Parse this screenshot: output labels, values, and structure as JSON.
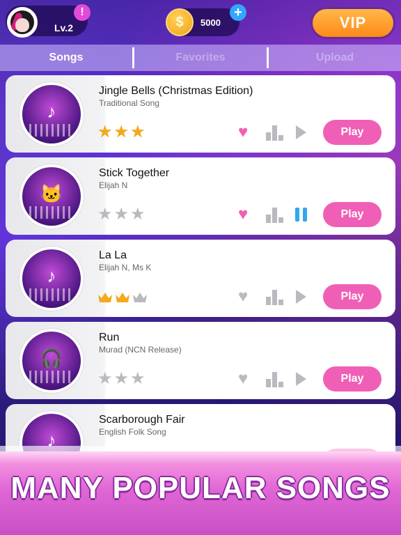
{
  "header": {
    "level": "Lv.2",
    "notification_icon": "!",
    "coins": "5000",
    "add_coins_icon": "+",
    "coin_symbol": "$",
    "vip_label": "VIP"
  },
  "tabs": [
    {
      "label": "Songs",
      "active": true
    },
    {
      "label": "Favorites",
      "active": false
    },
    {
      "label": "Upload",
      "active": false
    }
  ],
  "songs": [
    {
      "title": "Jingle Bells (Christmas Edition)",
      "artist": "Traditional Song",
      "disc_icon": "♪",
      "rating_type": "stars",
      "rating": 3,
      "rating_max": 3,
      "favorite": true,
      "playing": false,
      "button": "Play"
    },
    {
      "title": "Stick Together",
      "artist": "Elijah N",
      "disc_icon": "🐱",
      "rating_type": "stars",
      "rating": 0,
      "rating_max": 3,
      "favorite": true,
      "playing": true,
      "button": "Play"
    },
    {
      "title": "La La",
      "artist": "Elijah N, Ms K",
      "disc_icon": "♪",
      "rating_type": "crowns",
      "rating": 2,
      "rating_max": 3,
      "favorite": false,
      "playing": false,
      "button": "Play"
    },
    {
      "title": "Run",
      "artist": "Murad (NCN Release)",
      "disc_icon": "🎧",
      "rating_type": "stars",
      "rating": 0,
      "rating_max": 3,
      "favorite": false,
      "playing": false,
      "button": "Play"
    },
    {
      "title": "Scarborough Fair",
      "artist": "English Folk Song",
      "disc_icon": "♪",
      "rating_type": "stars",
      "rating": 0,
      "rating_max": 3,
      "favorite": false,
      "playing": false,
      "button": "Play"
    }
  ],
  "banner": {
    "text": "MANY POPULAR SONGS"
  },
  "colors": {
    "accent_pink": "#f05fb6",
    "star_gold": "#f6a81b",
    "inactive_gray": "#b9b9c0",
    "pause_blue": "#2fa8f0",
    "vip_orange": "#ff9a22"
  }
}
